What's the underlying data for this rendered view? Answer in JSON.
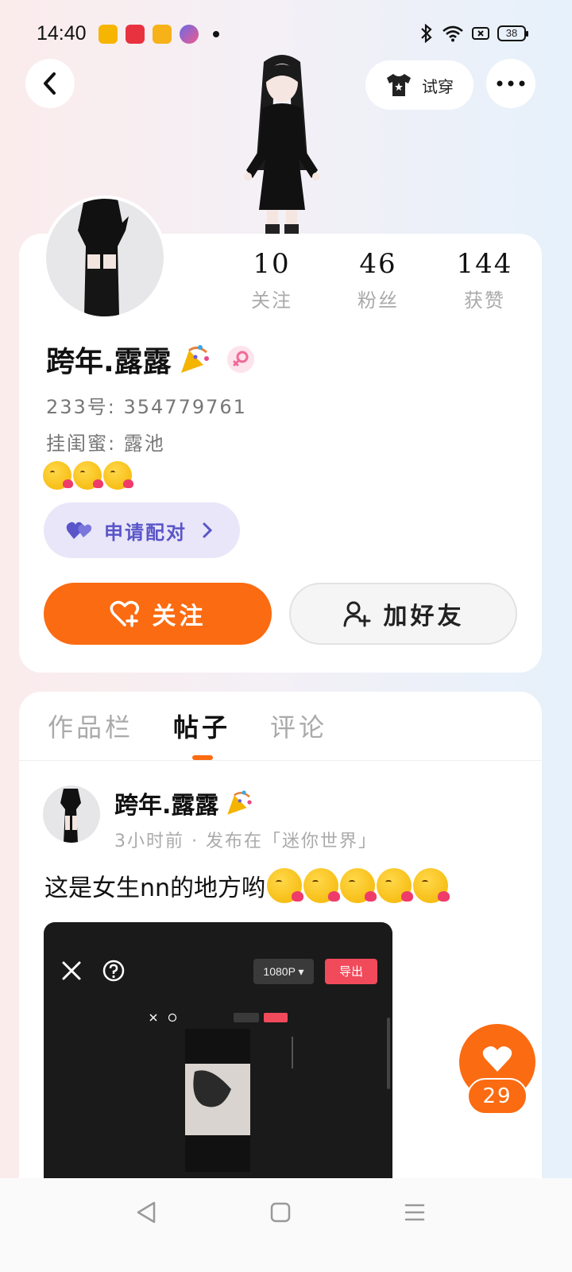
{
  "status_bar": {
    "time": "14:40",
    "battery": "38"
  },
  "header": {
    "tryon_label": "试穿"
  },
  "profile": {
    "stats": [
      {
        "value": "10",
        "label": "关注"
      },
      {
        "value": "46",
        "label": "粉丝"
      },
      {
        "value": "144",
        "label": "获赞"
      }
    ],
    "username": "跨年.露露",
    "id_line": "233号: 354779761",
    "bestie_line": "挂闺蜜: 露池",
    "pair_label": "申请配对",
    "follow_label": "关注",
    "add_friend_label": "加好友"
  },
  "tabs": [
    {
      "label": "作品栏"
    },
    {
      "label": "帖子"
    },
    {
      "label": "评论"
    }
  ],
  "post": {
    "author": "跨年.露露",
    "meta": "3小时前 · 发布在「迷你世界」",
    "text": "这是女生nn的地方哟",
    "image": {
      "resolution": "1080P",
      "export_label": "导出"
    },
    "like_count": "29"
  },
  "colors": {
    "accent": "#fb6b11",
    "pair_bg": "#e8e6f8",
    "pair_text": "#5a55c8"
  }
}
